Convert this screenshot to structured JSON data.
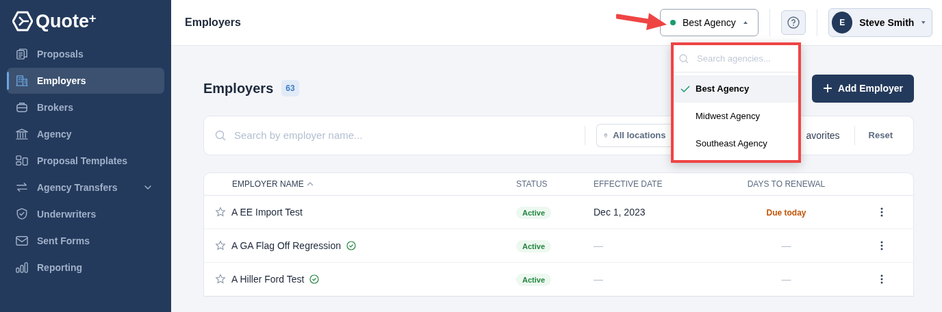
{
  "brand": {
    "name": "Quote",
    "mark": "+"
  },
  "sidebar": {
    "items": [
      {
        "label": "Proposals",
        "selected": false
      },
      {
        "label": "Employers",
        "selected": true
      },
      {
        "label": "Brokers",
        "selected": false
      },
      {
        "label": "Agency",
        "selected": false
      },
      {
        "label": "Proposal Templates",
        "selected": false
      },
      {
        "label": "Agency Transfers",
        "selected": false,
        "expanded": false
      },
      {
        "label": "Underwriters",
        "selected": false
      },
      {
        "label": "Sent Forms",
        "selected": false
      },
      {
        "label": "Reporting",
        "selected": false
      }
    ]
  },
  "header": {
    "title": "Employers",
    "agency_selector": {
      "label": "Best Agency",
      "color": "#1a9b6c",
      "expanded": true
    },
    "user": {
      "initial": "E",
      "name": "Steve Smith"
    }
  },
  "agency_dropdown": {
    "placeholder": "Search agencies...",
    "options": [
      {
        "label": "Best Agency",
        "selected": true
      },
      {
        "label": "Midwest Agency",
        "selected": false
      },
      {
        "label": "Southeast Agency",
        "selected": false
      }
    ]
  },
  "page": {
    "title": "Employers",
    "count": "63",
    "add_button": "Add Employer"
  },
  "filters": {
    "search_placeholder": "Search by employer name...",
    "location": "All locations",
    "favorites": "avorites",
    "reset": "Reset"
  },
  "table": {
    "columns": [
      {
        "label": "EMPLOYER NAME",
        "sorted": true
      },
      {
        "label": "STATUS",
        "sorted": false
      },
      {
        "label": "EFFECTIVE DATE",
        "sorted": false
      },
      {
        "label": "DAYS TO RENEWAL",
        "sorted": false
      }
    ],
    "rows": [
      {
        "name": "A EE Import Test",
        "favorite": false,
        "verified": false,
        "status": "Active",
        "effective_date": "Dec 1, 2023",
        "renewal": "Due today",
        "renewal_due": true
      },
      {
        "name": "A GA Flag Off Regression",
        "favorite": false,
        "verified": true,
        "status": "Active",
        "effective_date": "—",
        "renewal": "—",
        "renewal_due": false
      },
      {
        "name": "A Hiller Ford Test",
        "favorite": false,
        "verified": true,
        "status": "Active",
        "effective_date": "—",
        "renewal": "—",
        "renewal_due": false
      }
    ]
  }
}
